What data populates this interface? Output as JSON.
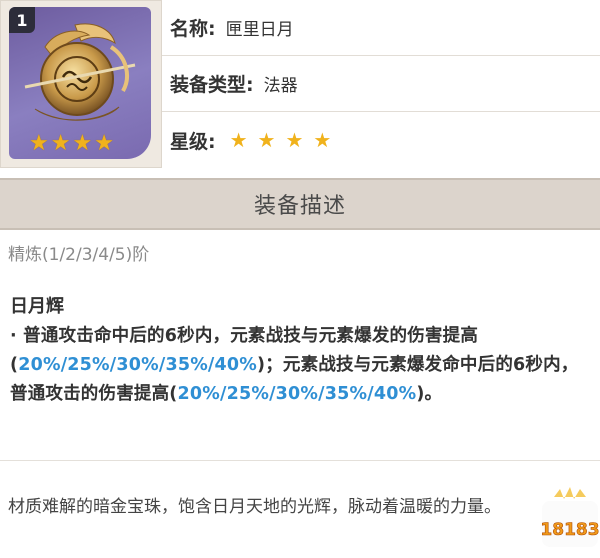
{
  "item": {
    "level_badge": "1",
    "name_label": "名称:",
    "name_value": "匣里日月",
    "type_label": "装备类型:",
    "type_value": "法器",
    "rarity_label": "星级:",
    "rarity_stars": [
      "★",
      "★",
      "★",
      "★"
    ],
    "thumb_stars": [
      "★",
      "★",
      "★",
      "★"
    ],
    "icon": "catalyst-orb-icon"
  },
  "description": {
    "header": "装备描述",
    "refinement": "精炼(1/2/3/4/5)阶",
    "skill_name": "日月辉",
    "skill_bullet": "·",
    "skill_text_1": "普通攻击命中后的6秒内，元素战技与元素爆发的伤害提高(",
    "skill_hl_1": "20%/25%/30%/35%/40%",
    "skill_text_2": ")；元素战技与元素爆发命中后的6秒内，普通攻击的伤害提高(",
    "skill_hl_2": "20%/25%/30%/35%/40%",
    "skill_text_3": ")。",
    "flavor": "材质难解的暗金宝珠，饱含日月天地的光辉，脉动着温暖的力量。"
  },
  "watermark": {
    "text": "18183"
  },
  "colors": {
    "highlight": "#2f8fd4",
    "star": "#f0b21c",
    "header_bg": "#dcd4cc",
    "thumb_bg": "#7a6ab0"
  }
}
